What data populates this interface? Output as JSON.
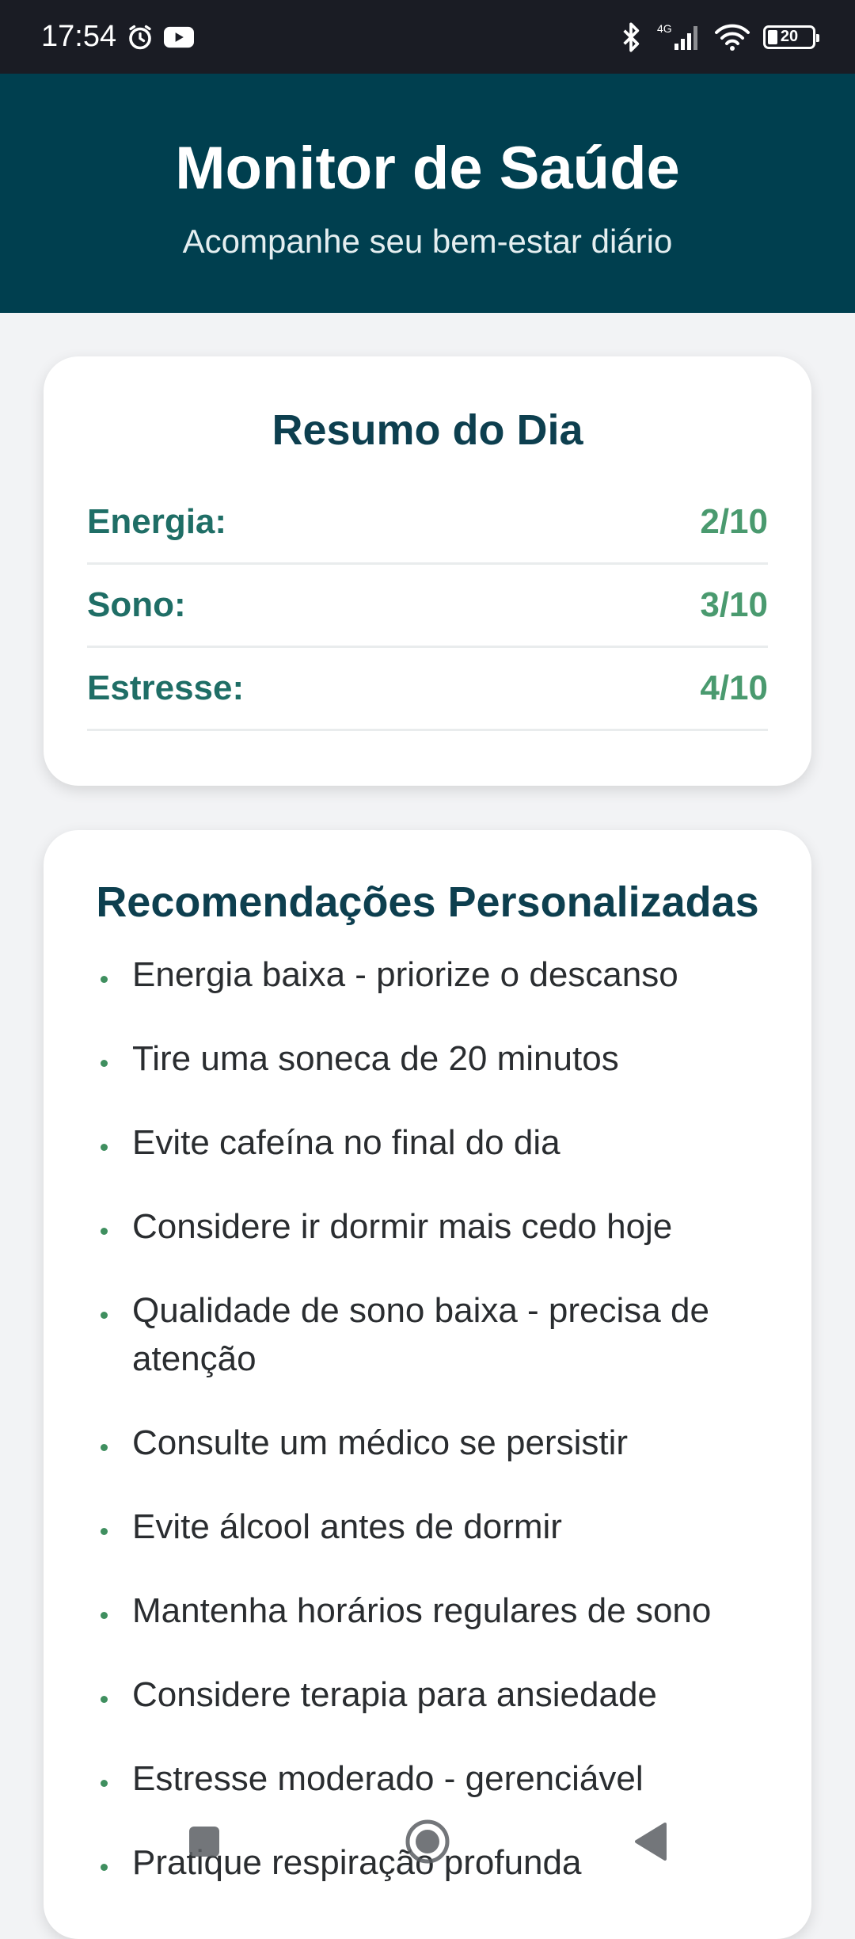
{
  "status_bar": {
    "time": "17:54",
    "icons": [
      "alarm-icon",
      "youtube-icon",
      "bluetooth-icon",
      "signal-4g-icon",
      "wifi-icon",
      "battery-icon"
    ],
    "network_label": "4G",
    "battery": "20"
  },
  "header": {
    "title": "Monitor de Saúde",
    "subtitle": "Acompanhe seu bem-estar diário",
    "background_color": "#003f4f"
  },
  "summary": {
    "title": "Resumo do Dia",
    "metrics": [
      {
        "label": "Energia:",
        "value": "2/10"
      },
      {
        "label": "Sono:",
        "value": "3/10"
      },
      {
        "label": "Estresse:",
        "value": "4/10"
      }
    ]
  },
  "recommendations": {
    "title": "Recomendações Personalizadas",
    "items": [
      "Energia baixa - priorize o descanso",
      "Tire uma soneca de 20 minutos",
      "Evite cafeína no final do dia",
      "Considere ir dormir mais cedo hoje",
      "Qualidade de sono baixa - precisa de atenção",
      "Consulte um médico se persistir",
      "Evite álcool antes de dormir",
      "Mantenha horários regulares de sono",
      "Considere terapia para ansiedade",
      "Estresse moderado - gerenciável",
      "Pratique respiração profunda"
    ]
  },
  "nav_bar": {
    "buttons": [
      "recents-button",
      "home-button",
      "back-button"
    ]
  }
}
